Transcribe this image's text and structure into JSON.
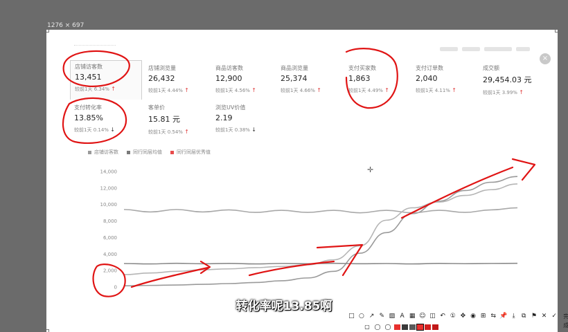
{
  "screen": {
    "size_label": "1276 × 697"
  },
  "kpis": [
    {
      "name": "店铺访客数",
      "value": "13,451",
      "cmp": "较前1天",
      "pct": "6.34%",
      "dir": "up",
      "selected": true
    },
    {
      "name": "店铺浏览量",
      "value": "26,432",
      "cmp": "较前1天",
      "pct": "4.44%",
      "dir": "up",
      "selected": false
    },
    {
      "name": "商品访客数",
      "value": "12,900",
      "cmp": "较前1天",
      "pct": "4.56%",
      "dir": "up",
      "selected": false
    },
    {
      "name": "商品浏览量",
      "value": "25,374",
      "cmp": "较前1天",
      "pct": "4.66%",
      "dir": "up",
      "selected": false
    },
    {
      "name": "支付买家数",
      "value": "1,863",
      "cmp": "较前1天",
      "pct": "4.49%",
      "dir": "up",
      "selected": false
    },
    {
      "name": "支付订单数",
      "value": "2,040",
      "cmp": "较前1天",
      "pct": "4.11%",
      "dir": "up",
      "selected": false
    },
    {
      "name": "成交额",
      "value": "29,454.03 元",
      "cmp": "较前1天",
      "pct": "3.99%",
      "dir": "up",
      "selected": false
    },
    {
      "name": "支付转化率",
      "value": "13.85%",
      "cmp": "较前1天",
      "pct": "0.14%",
      "dir": "down",
      "selected": false
    },
    {
      "name": "客单价",
      "value": "15.81 元",
      "cmp": "较前1天",
      "pct": "0.54%",
      "dir": "up",
      "selected": false
    },
    {
      "name": "浏览UV价值",
      "value": "2.19",
      "cmp": "较前1天",
      "pct": "0.38%",
      "dir": "down",
      "selected": false
    }
  ],
  "legend": [
    {
      "label": "店铺访客数",
      "color": "#9a9a9a"
    },
    {
      "label": "同行同层均值",
      "color": "#7a7a7a"
    },
    {
      "label": "同行同层优秀值",
      "color": "#e84c4c"
    }
  ],
  "chart_data": {
    "type": "line",
    "y_ticks": [
      "14,000",
      "12,000",
      "10,000",
      "8,000",
      "6,000",
      "4,000",
      "2,000",
      "0"
    ],
    "ylim": [
      0,
      14000
    ],
    "grid": false,
    "series": [
      {
        "name": "店铺访客数",
        "color": "#9a9a9a",
        "values": [
          150,
          200,
          250,
          330,
          420,
          550,
          760,
          1100,
          1900,
          4100,
          6600,
          8900,
          10400,
          11700,
          12700,
          13400
        ]
      },
      {
        "name": "同行同层均值",
        "color": "#8a8a8a",
        "values": [
          2850,
          2800,
          2880,
          2820,
          2870,
          2800,
          2860,
          2830,
          2880,
          2820,
          2850,
          2800,
          2870,
          2830,
          2860,
          2880
        ]
      },
      {
        "name": "同行同层优秀值",
        "color": "#a8a8a8",
        "values": [
          9400,
          9100,
          9400,
          9100,
          9350,
          9050,
          9300,
          9050,
          9300,
          9000,
          9300,
          9000,
          9300,
          9050,
          9350,
          9600
        ]
      },
      {
        "name": "",
        "color": "#b5b5b5",
        "values": [
          1500,
          1700,
          1900,
          2100,
          2200,
          2350,
          2500,
          2700,
          3300,
          5000,
          8100,
          9600,
          10300,
          11100,
          11800,
          12500
        ]
      }
    ]
  },
  "caption": {
    "text": "转化率呢13.85啊"
  },
  "toolbar": {
    "tools": [
      {
        "name": "rectangle-tool",
        "glyph": "□"
      },
      {
        "name": "ellipse-tool",
        "glyph": "○"
      },
      {
        "name": "arrow-tool",
        "glyph": "↗"
      },
      {
        "name": "pen-tool",
        "glyph": "✎"
      },
      {
        "name": "marker-tool",
        "glyph": "▨"
      },
      {
        "name": "text-tool",
        "glyph": "A"
      },
      {
        "name": "mosaic-tool",
        "glyph": "▦"
      },
      {
        "name": "sticker-tool",
        "glyph": "☺"
      },
      {
        "name": "eraser-tool",
        "glyph": "◫"
      },
      {
        "name": "undo-tool",
        "glyph": "↶"
      },
      {
        "name": "number-tool",
        "glyph": "①"
      },
      {
        "name": "pin-tool",
        "glyph": "✥"
      },
      {
        "name": "fill-tool",
        "glyph": "◉"
      },
      {
        "name": "ocr-tool",
        "glyph": "⊞"
      },
      {
        "name": "translate-tool",
        "glyph": "⇆"
      },
      {
        "name": "pin-window-tool",
        "glyph": "📌"
      },
      {
        "name": "save-tool",
        "glyph": "⤓"
      },
      {
        "name": "copy-tool",
        "glyph": "⧉"
      },
      {
        "name": "bookmark-tool",
        "glyph": "⚑"
      },
      {
        "name": "cancel-tool",
        "glyph": "✕"
      },
      {
        "name": "confirm-tool",
        "glyph": "✓"
      }
    ],
    "done_label": "完成",
    "colors": [
      "#e8302e",
      "#3a3a3a",
      "#5a5a5a",
      "#e8302e",
      "#d42020",
      "#c01818"
    ],
    "selected_color": 3
  }
}
